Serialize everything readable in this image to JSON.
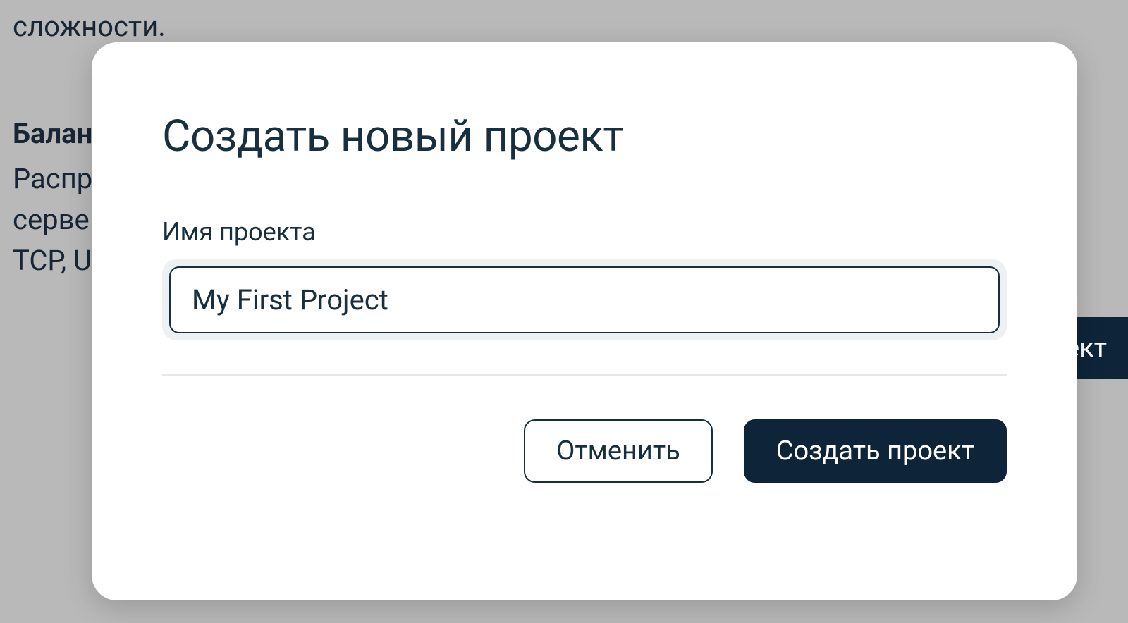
{
  "background": {
    "line1": "сложности.",
    "heading": "Балан",
    "paragraph_l1": "Распр",
    "paragraph_l2": "серве",
    "paragraph_l3": "TCP, U",
    "button_fragment": "ект"
  },
  "modal": {
    "title": "Создать новый проект",
    "field_label": "Имя проекта",
    "input_value": "My First Project",
    "cancel_label": "Отменить",
    "submit_label": "Создать проект"
  }
}
